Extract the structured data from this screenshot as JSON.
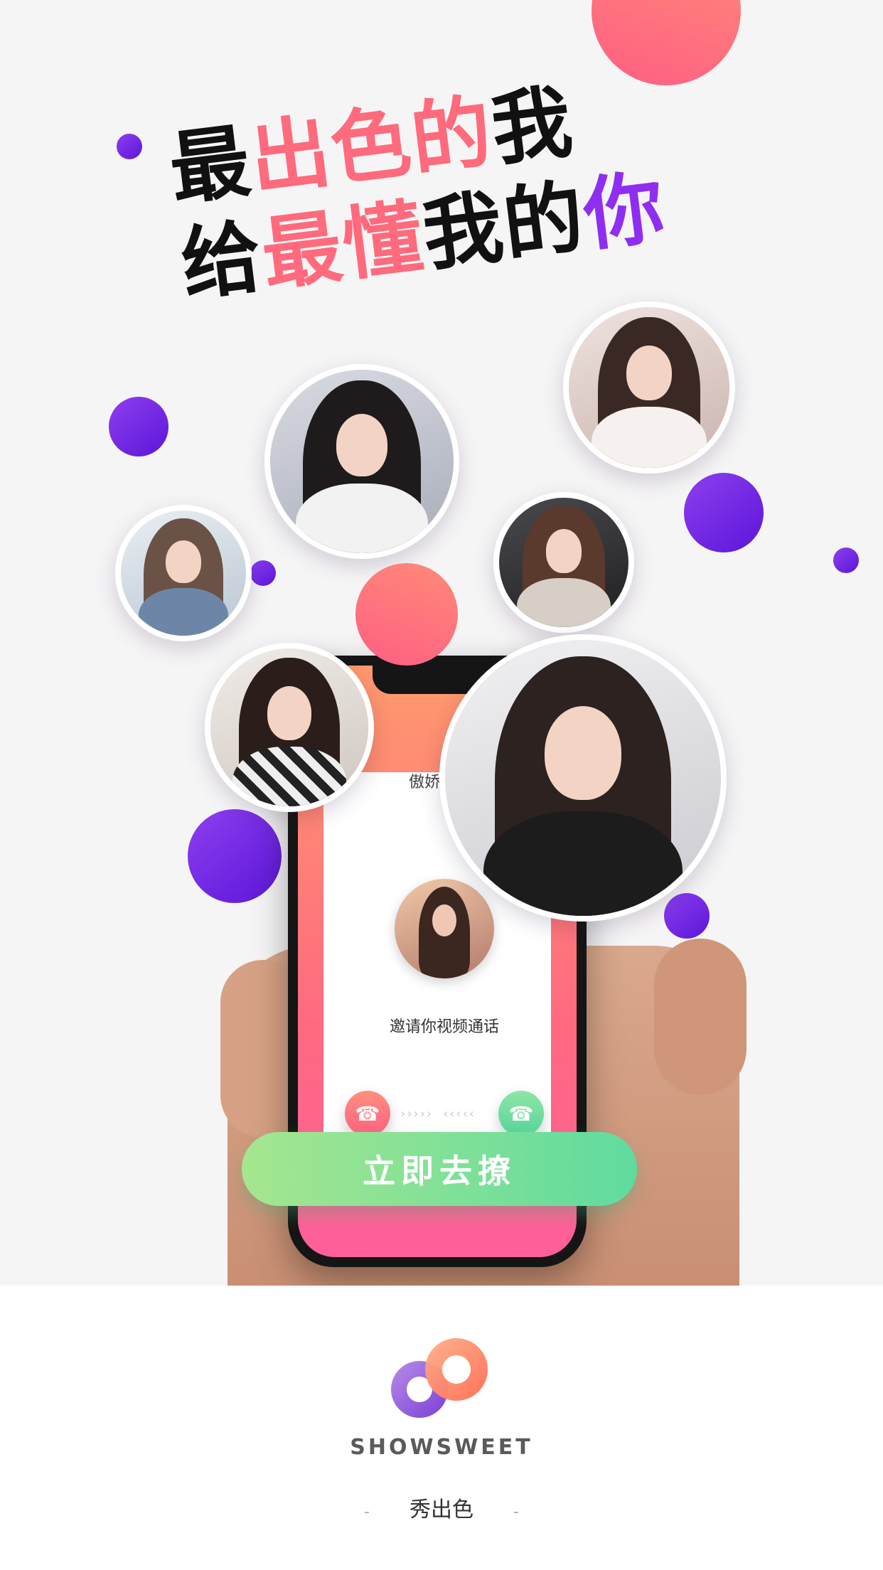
{
  "slogan": {
    "line1_part1": "最",
    "line1_highlight": "出色的",
    "line1_part2": "我",
    "line2_part1": "给",
    "line2_highlight": "最懂",
    "line2_part2": "我的",
    "line2_highlight2": "你"
  },
  "call_screen": {
    "caller_name": "傲娇小姐姐",
    "invite_text": "邀请你视频通话",
    "decline_icon": "phone-hangup-icon",
    "accept_icon": "phone-answer-icon",
    "arrows_left": "›››››",
    "arrows_right": "‹‹‹‹‹"
  },
  "cta": {
    "label": "立即去撩"
  },
  "footer": {
    "brand": "SHOWSWEET",
    "tagline": "秀出色",
    "dash": "-"
  },
  "colors": {
    "coral": "#ff6a7c",
    "violet": "#7a22e6",
    "cta_start": "#a6e68f",
    "cta_end": "#5fdb9f",
    "text": "#111111"
  }
}
